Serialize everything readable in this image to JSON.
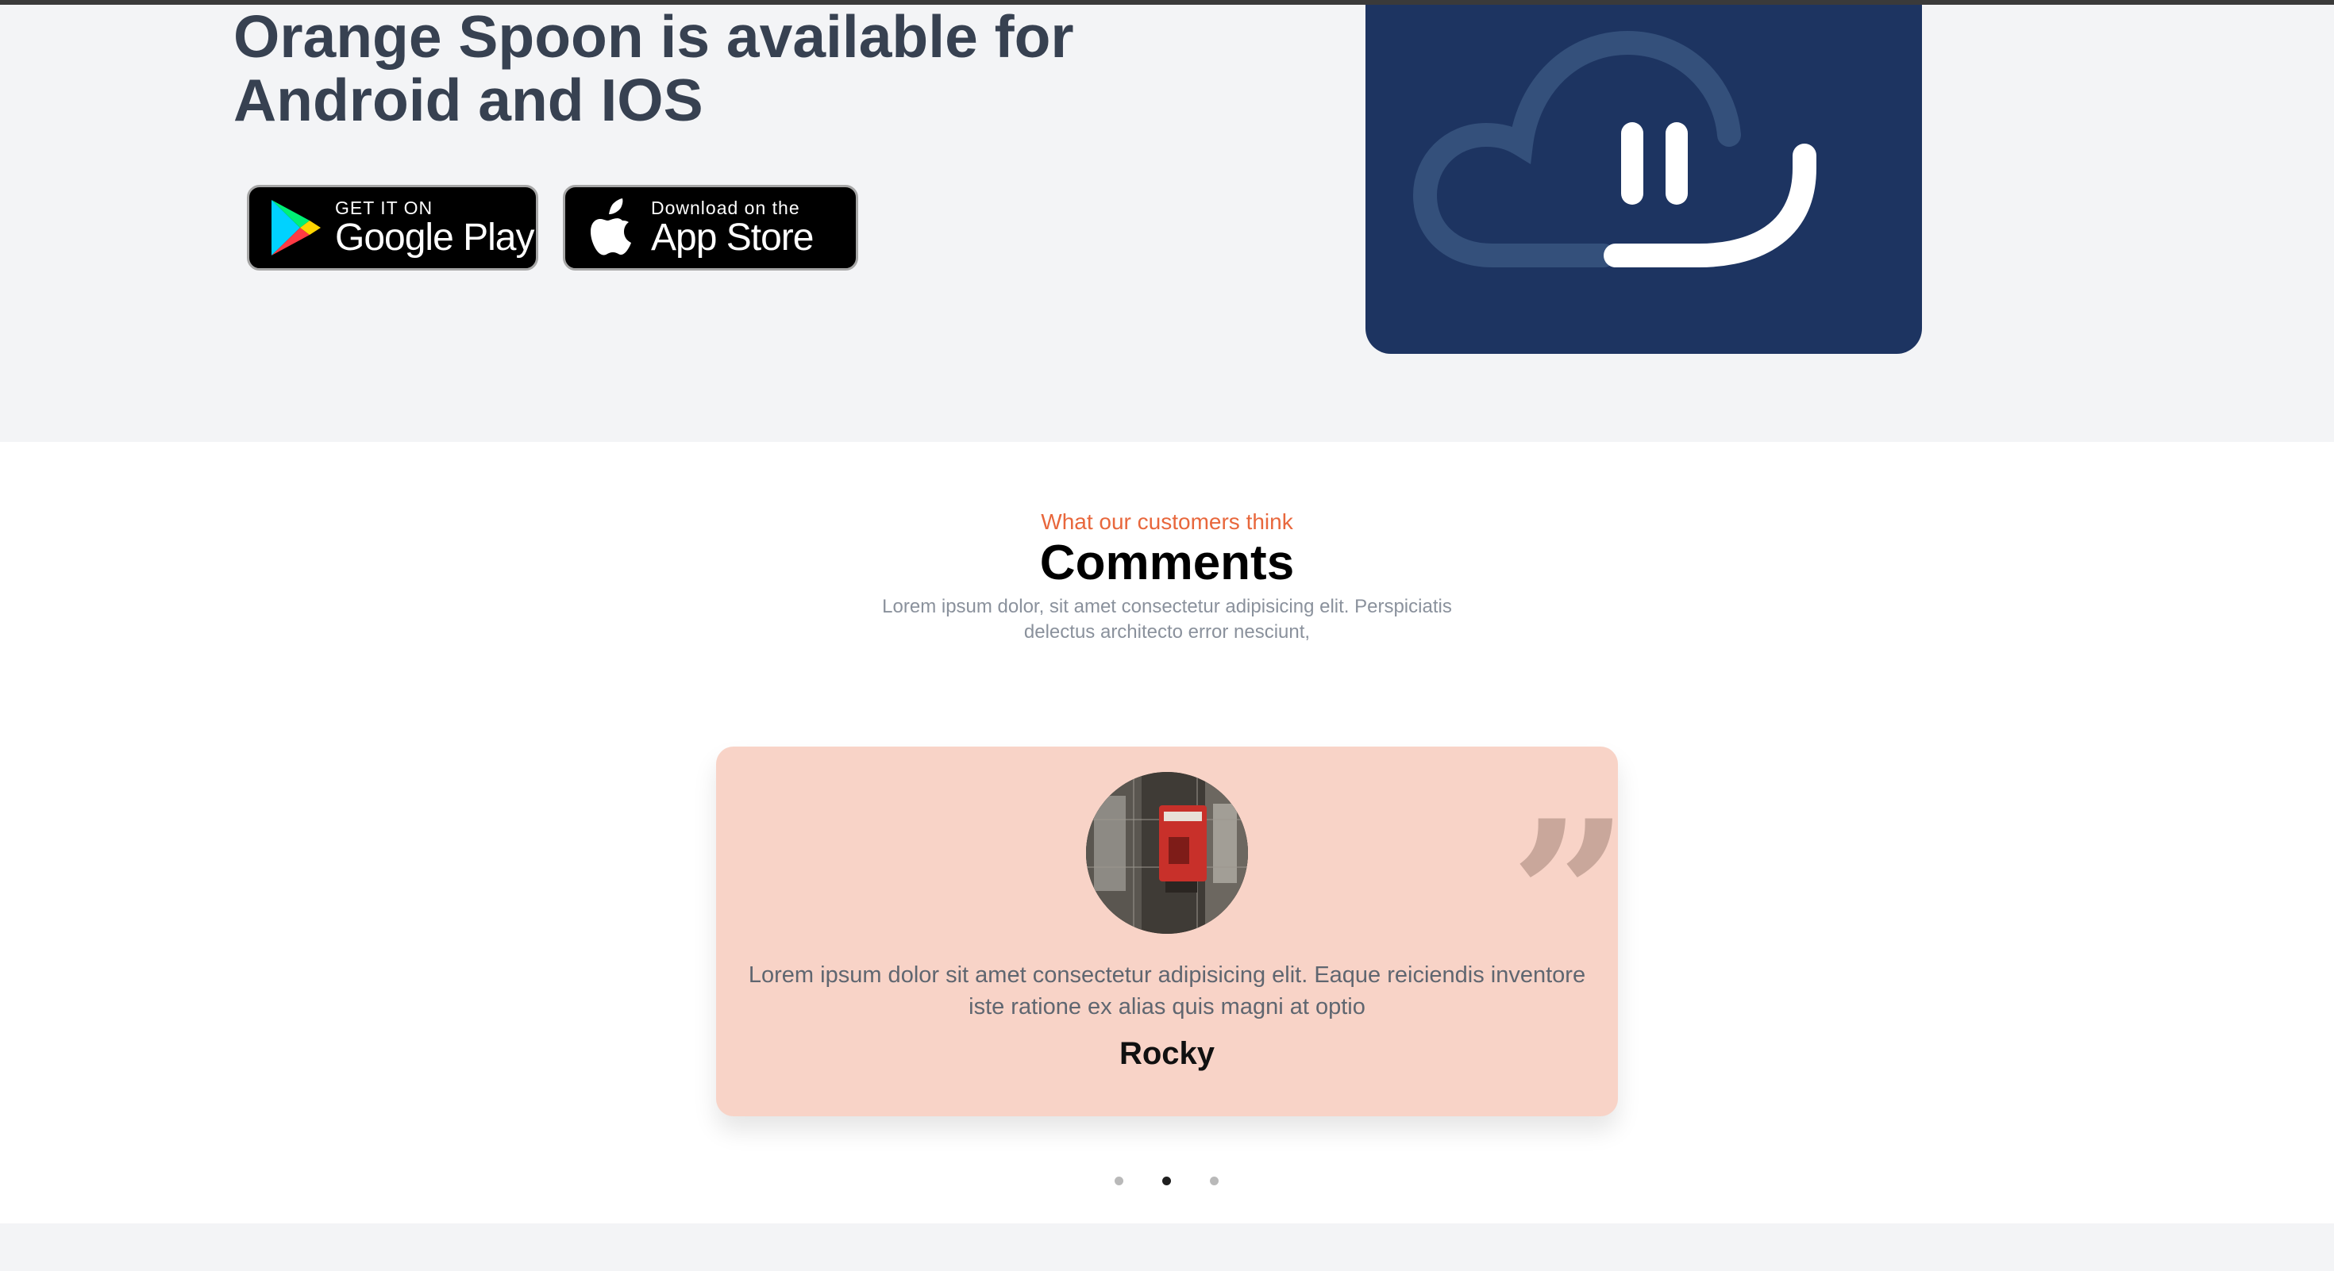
{
  "app_section": {
    "title_line1": "Orange Spoon is available for",
    "title_line2": "Android and IOS",
    "google_play": {
      "small": "GET IT ON",
      "big": "Google Play"
    },
    "app_store": {
      "small": "Download on the",
      "big": "App Store"
    }
  },
  "comments_section": {
    "kicker": "What our customers think",
    "title": "Comments",
    "description": "Lorem ipsum dolor, sit amet consectetur adipisicing elit. Perspiciatis delectus architecto error nesciunt,",
    "testimonial": {
      "quote_mark": "”",
      "text": "Lorem ipsum dolor sit amet consectetur adipisicing elit. Eaque reiciendis inventore iste ratione ex alias quis magni at optio",
      "name": "Rocky"
    },
    "carousel": {
      "total": 3,
      "active": 2
    }
  },
  "colors": {
    "accent": "#e8673c",
    "card_bg": "#f8d3c7",
    "cloud_card_bg": "#1d3461"
  }
}
